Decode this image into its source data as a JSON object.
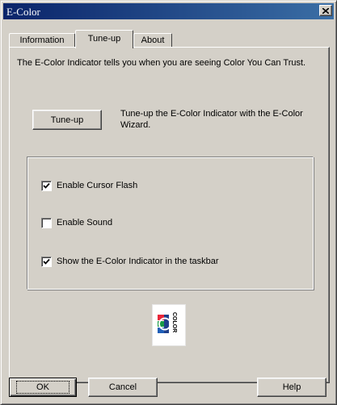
{
  "window": {
    "title": "E-Color"
  },
  "tabs": [
    {
      "label": "Information"
    },
    {
      "label": "Tune-up"
    },
    {
      "label": "About"
    }
  ],
  "intro_text": "The E-Color Indicator tells you when you are seeing Color You Can Trust.",
  "tuneup": {
    "button_label": "Tune-up",
    "description": "Tune-up the E-Color Indicator with the E-Color Wizard."
  },
  "options": [
    {
      "label": "Enable Cursor Flash",
      "checked": true
    },
    {
      "label": "Enable Sound",
      "checked": false
    },
    {
      "label": "Show the E-Color Indicator in the taskbar",
      "checked": true
    }
  ],
  "logo": {
    "text": "COLOR"
  },
  "buttons": {
    "ok": "OK",
    "cancel": "Cancel",
    "help": "Help"
  },
  "colors": {
    "title_start": "#0a246a",
    "title_end": "#3a6ea5",
    "face": "#d4d0c8",
    "logo_red": "#e8263a",
    "logo_green": "#1a9a48",
    "logo_blue": "#1f5fb8"
  }
}
